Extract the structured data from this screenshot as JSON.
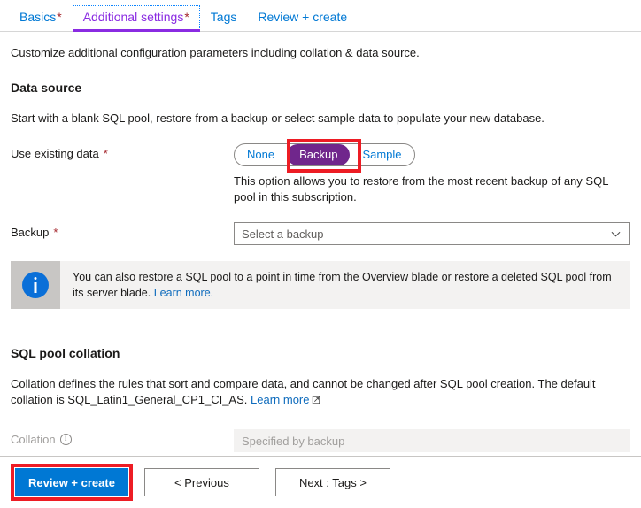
{
  "wizard": {
    "tabs": [
      {
        "label": "Basics",
        "required": true,
        "active": false
      },
      {
        "label": "Additional settings",
        "required": true,
        "active": true
      },
      {
        "label": "Tags",
        "required": false,
        "active": false
      },
      {
        "label": "Review + create",
        "required": false,
        "active": false
      }
    ]
  },
  "page": {
    "intro": "Customize additional configuration parameters including collation & data source."
  },
  "data_source": {
    "heading": "Data source",
    "description": "Start with a blank SQL pool, restore from a backup or select sample data to populate your new database.",
    "use_existing_data": {
      "label": "Use existing data",
      "required_marker": "*",
      "options": [
        "None",
        "Backup",
        "Sample"
      ],
      "selected": "Backup",
      "help_text": "This option allows you to restore from the most recent backup of any SQL pool in this subscription."
    },
    "backup": {
      "label": "Backup",
      "required_marker": "*",
      "placeholder": "Select a backup",
      "chevron_icon": "chevron-down-icon"
    },
    "banner": {
      "icon": "info-icon",
      "text": "You can also restore a SQL pool to a point in time from the Overview blade or restore a deleted SQL pool from its server blade. ",
      "link_label": "Learn more."
    }
  },
  "collation": {
    "heading": "SQL pool collation",
    "description": "Collation defines the rules that sort and compare data, and cannot be changed after SQL pool creation. The default collation is SQL_Latin1_General_CP1_CI_AS. ",
    "link_label": "Learn more",
    "link_icon": "external-link-icon",
    "field": {
      "label": "Collation",
      "info_icon": "info-circle-icon",
      "value": "Specified by backup",
      "disabled": true
    }
  },
  "footer": {
    "review_create_label": "Review + create",
    "previous_label": "< Previous",
    "next_label": "Next : Tags >"
  },
  "annotations": {
    "highlight_color": "#ed1c24",
    "targets": [
      "use-existing-data-backup-option",
      "review-create-button"
    ]
  },
  "colors": {
    "accent_blue": "#0078d4",
    "selected_purple": "#70268c",
    "active_tab_purple": "#8a2be2",
    "link_blue": "#0f6cbd",
    "required_red": "#a4262c",
    "annotation_red": "#ed1c24",
    "banner_bg": "#f3f2f1",
    "banner_icon_bg": "#c8c6c4"
  }
}
